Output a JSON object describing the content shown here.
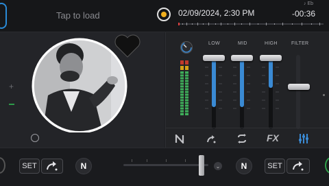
{
  "top": {
    "load_prompt": "Tap to load",
    "datetime": "02/09/2024, 2:30 PM",
    "key": "♪ Eb",
    "time_remaining": "-00:36"
  },
  "mixer": {
    "eq_labels": {
      "low": "LOW",
      "mid": "MID",
      "high": "HIGH",
      "filter": "FILTER"
    },
    "icons": {
      "fx_label": "FX"
    }
  },
  "bottom": {
    "set_left": "SET",
    "set_right": "SET",
    "n_left": "N",
    "n_right": "N"
  },
  "colors": {
    "accent_blue": "#3a8ad4",
    "play_yellow": "#f2b01e",
    "green": "#2fa04a"
  },
  "icons": [
    "heart-icon",
    "play-indicator-icon",
    "loop-icon",
    "sync-icon",
    "equalizer-icon",
    "chevron-down-icon",
    "cue-arrow-icon",
    "neutron-icon"
  ]
}
